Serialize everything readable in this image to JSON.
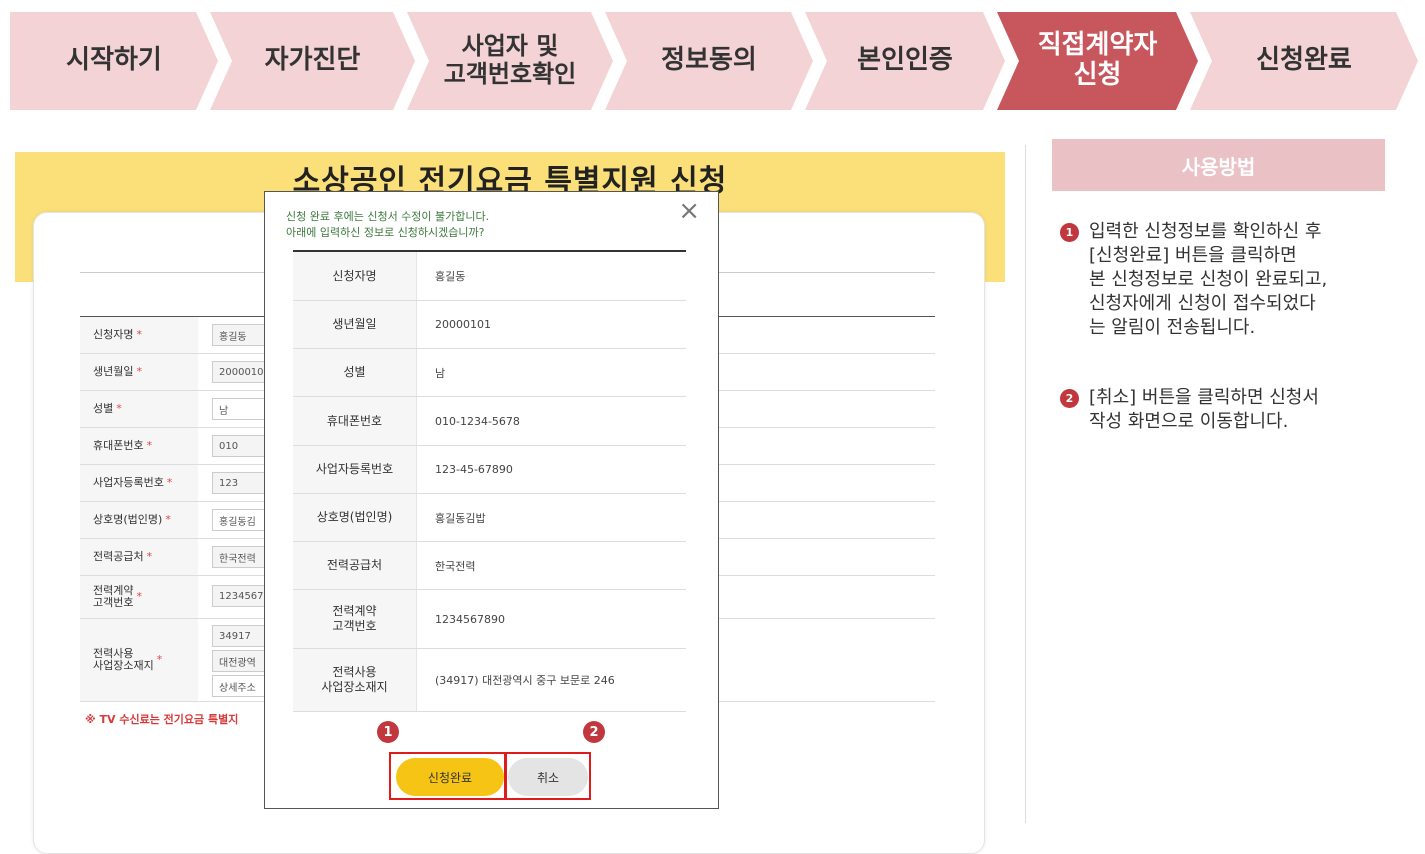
{
  "steps": [
    {
      "label": "시작하기"
    },
    {
      "label": "자가진단"
    },
    {
      "label": "사업자 및\n고객번호확인"
    },
    {
      "label": "정보동의"
    },
    {
      "label": "본인인증"
    },
    {
      "label": "직접계약자\n신청",
      "active": true
    },
    {
      "label": "신청완료"
    }
  ],
  "page": {
    "title": "소상공인 전기요금 특별지원 신청"
  },
  "form": {
    "required_mark": "*",
    "rows": [
      {
        "label": "신청자명",
        "value": "홍길동"
      },
      {
        "label": "생년월일",
        "value": "2000010"
      },
      {
        "label": "성별",
        "value": "남"
      },
      {
        "label": "휴대폰번호",
        "value": "010"
      },
      {
        "label": "사업자등록번호",
        "value": "123"
      },
      {
        "label": "상호명(법인명)",
        "value": "홍길동김"
      },
      {
        "label": "전력공급처",
        "value": "한국전력"
      },
      {
        "label": "전력계약\n고객번호",
        "value": "1234567"
      },
      {
        "label": "전력사용\n사업장소재지",
        "values": [
          "34917",
          "대전광역",
          "상세주소"
        ]
      }
    ],
    "notice": "※ TV 수신료는 전기요금 특별지"
  },
  "modal": {
    "message_line1": "신청 완료 후에는 신청서 수정이 불가합니다.",
    "message_line2": "아래에 입력하신 정보로 신청하시겠습니까?",
    "close_icon": "×",
    "rows": [
      {
        "label": "신청자명",
        "value": "홍길동"
      },
      {
        "label": "생년월일",
        "value": "20000101"
      },
      {
        "label": "성별",
        "value": "남"
      },
      {
        "label": "휴대폰번호",
        "value": "010-1234-5678"
      },
      {
        "label": "사업자등록번호",
        "value": "123-45-67890"
      },
      {
        "label": "상호명(법인명)",
        "value": "홍길동김밥"
      },
      {
        "label": "전력공급처",
        "value": "한국전력"
      },
      {
        "label": "전력계약\n고객번호",
        "value": "1234567890"
      },
      {
        "label": "전력사용\n사업장소재지",
        "value": "(34917) 대전광역시 중구 보문로 246"
      }
    ],
    "badge1": "1",
    "badge2": "2",
    "confirm_label": "신청완료",
    "cancel_label": "취소"
  },
  "help": {
    "title": "사용방법",
    "item1_num": "1",
    "item1_text": "입력한 신청정보를 확인하신 후\n[신청완료] 버튼을 클릭하면\n본 신청정보로 신청이 완료되고,\n신청자에게 신청이 접수되었다\n는 알림이 전송됩니다.",
    "item2_num": "2",
    "item2_text": "[취소] 버튼을 클릭하면 신청서\n작성 화면으로 이동합니다."
  },
  "colors": {
    "accent": "#c8565d",
    "step_bg": "#f3d3d5",
    "banner": "#fbe07a",
    "confirm_btn": "#f6c415",
    "badge": "#c0383d"
  }
}
